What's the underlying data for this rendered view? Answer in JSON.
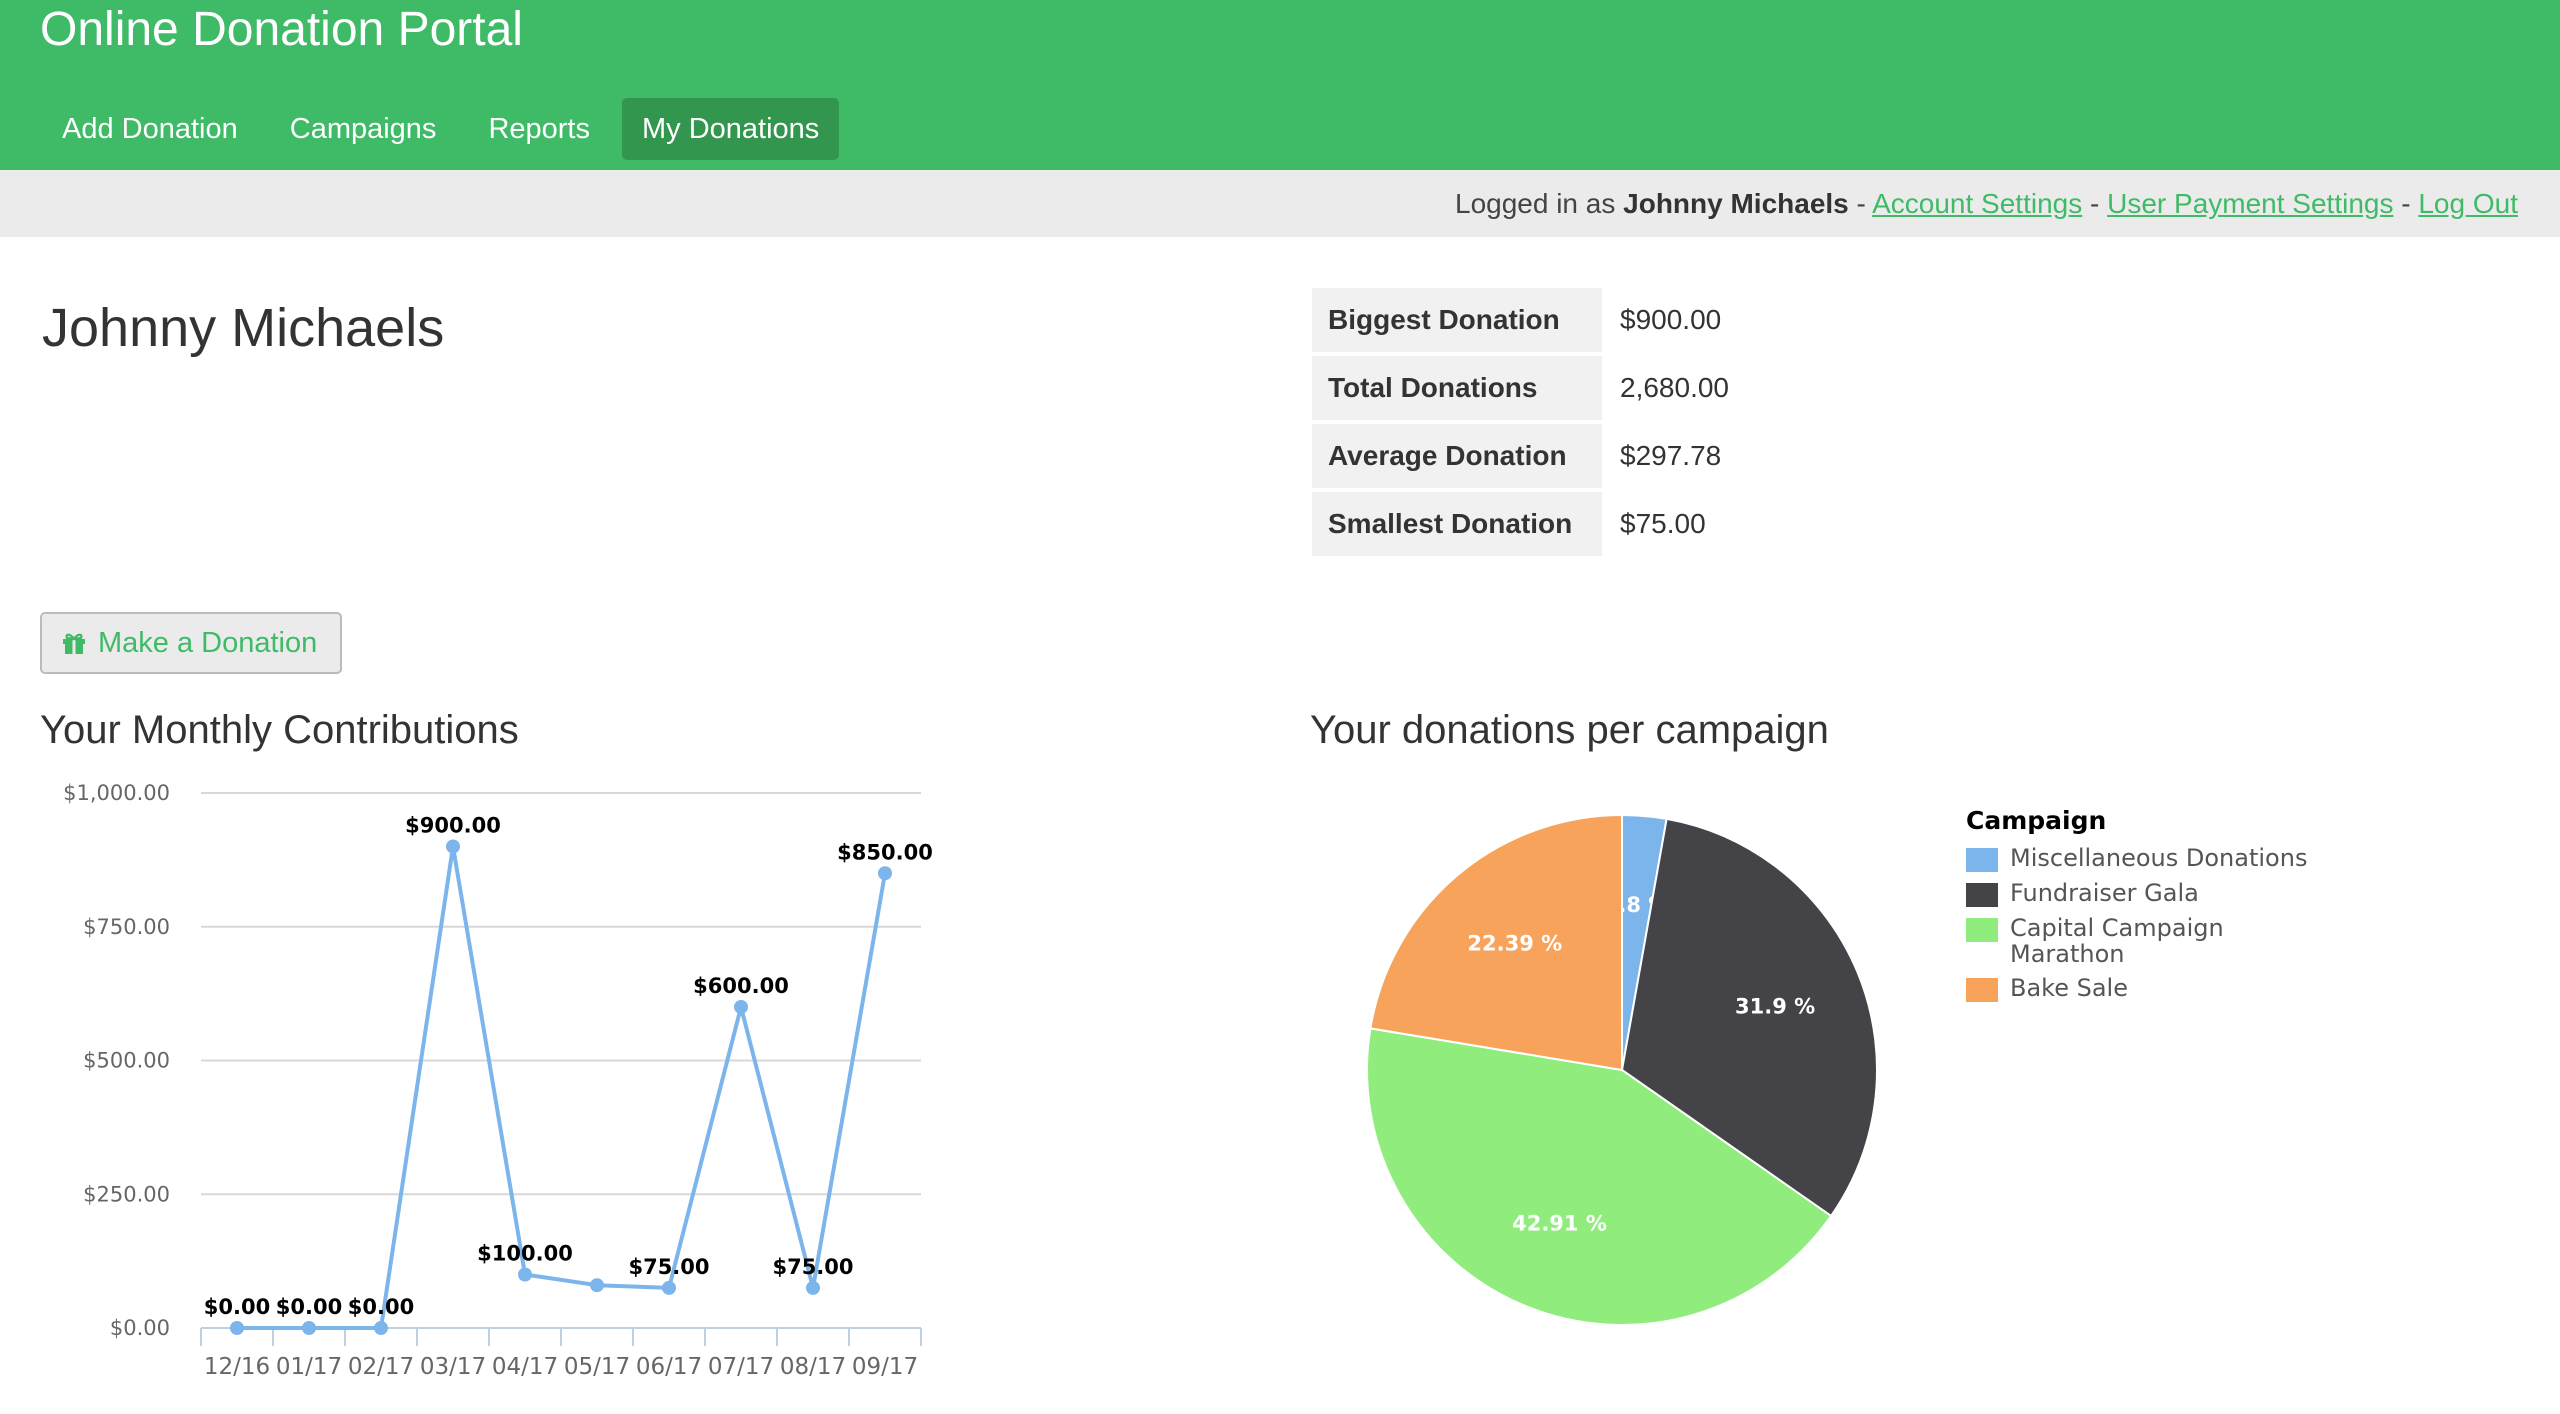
{
  "app": {
    "title": "Online Donation Portal"
  },
  "nav": {
    "items": [
      {
        "label": "Add Donation",
        "active": false
      },
      {
        "label": "Campaigns",
        "active": false
      },
      {
        "label": "Reports",
        "active": false
      },
      {
        "label": "My Donations",
        "active": true
      }
    ]
  },
  "userbar": {
    "prefix": "Logged in as ",
    "username": "Johnny Michaels",
    "separator": " - ",
    "account_settings": "Account Settings",
    "payment_settings": "User Payment Settings",
    "logout": "Log Out"
  },
  "profile": {
    "name": "Johnny Michaels"
  },
  "stats": [
    {
      "label": "Biggest Donation",
      "value": "$900.00"
    },
    {
      "label": "Total Donations",
      "value": "2,680.00"
    },
    {
      "label": "Average Donation",
      "value": "$297.78"
    },
    {
      "label": "Smallest Donation",
      "value": "$75.00"
    }
  ],
  "donate_button": {
    "label": "Make a Donation",
    "icon": "gift-icon"
  },
  "colors": {
    "brand": "#3fbb67",
    "brand_dark": "#33964f",
    "line": "#7cb5ec"
  },
  "chart_data": [
    {
      "type": "line",
      "title": "Your Monthly Contributions",
      "categories": [
        "12/16",
        "01/17",
        "02/17",
        "03/17",
        "04/17",
        "05/17",
        "06/17",
        "07/17",
        "08/17",
        "09/17"
      ],
      "values": [
        0,
        0,
        0,
        900,
        100,
        80,
        75,
        600,
        75,
        850
      ],
      "data_labels": [
        "$0.00",
        "$0.00",
        "$0.00",
        "$900.00",
        "$100.00",
        "",
        "$75.00",
        "$600.00",
        "$75.00",
        "$850.00"
      ],
      "yticks": [
        0,
        250,
        500,
        750,
        1000
      ],
      "ytick_labels": [
        "$0.00",
        "$250.00",
        "$500.00",
        "$750.00",
        "$1,000.00"
      ],
      "ylim": [
        0,
        1000
      ],
      "xlabel": "",
      "ylabel": "",
      "grid": true,
      "color": "#7cb5ec"
    },
    {
      "type": "pie",
      "title": "Your donations per campaign",
      "legend_title": "Campaign",
      "legend_position": "right",
      "slices": [
        {
          "name": "Miscellaneous Donations",
          "value": 2.8,
          "label": "2.8 %",
          "color": "#7cb5ec"
        },
        {
          "name": "Fundraiser Gala",
          "value": 31.9,
          "label": "31.9 %",
          "color": "#434348"
        },
        {
          "name": "Capital Campaign Marathon",
          "value": 42.91,
          "label": "42.91 %",
          "color": "#90ed7d"
        },
        {
          "name": "Bake Sale",
          "value": 22.39,
          "label": "22.39 %",
          "color": "#f7a35c"
        }
      ]
    }
  ]
}
